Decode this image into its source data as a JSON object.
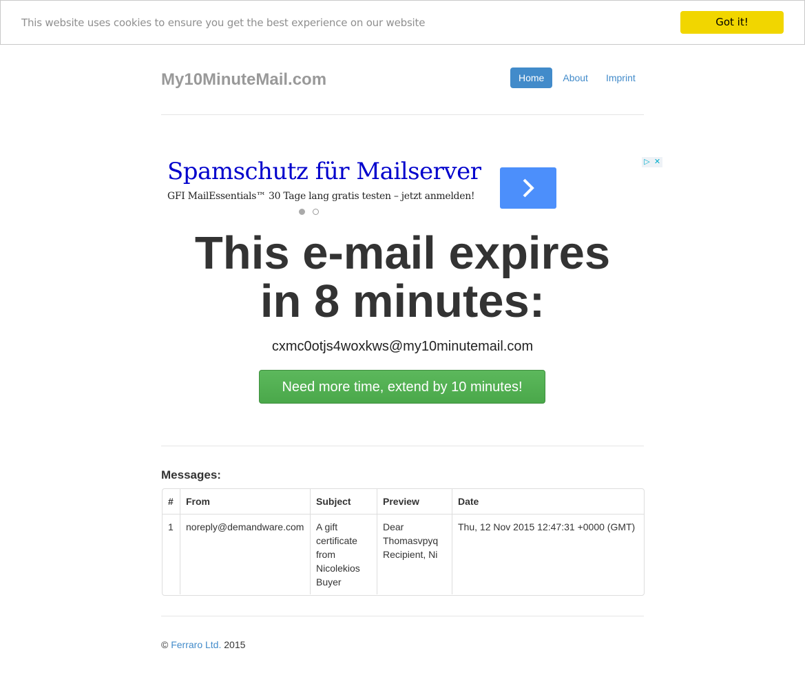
{
  "cookie": {
    "text": "This website uses cookies to ensure you get the best experience on our website",
    "button": "Got it!"
  },
  "header": {
    "brand": "My10MinuteMail.com",
    "nav": [
      "Home",
      "About",
      "Imprint"
    ],
    "active": "Home"
  },
  "ad": {
    "title": "Spamschutz für Mailserver",
    "subtitle": "GFI MailEssentials™ 30 Tage lang gratis testen – jetzt anmelden!",
    "arrow_icon": "chevron-right-icon",
    "choices_icons": [
      "ad-choices-icon",
      "close-icon"
    ]
  },
  "main": {
    "headline_line1": "This e-mail expires",
    "headline_line2": "in 8 minutes:",
    "address": "cxmc0otjs4woxkws@my10minutemail.com",
    "extend_button": "Need more time, extend by 10 minutes!"
  },
  "messages": {
    "title": "Messages:",
    "columns": [
      "#",
      "From",
      "Subject",
      "Preview",
      "Date"
    ],
    "rows": [
      {
        "num": "1",
        "from": "noreply@demandware.com",
        "subject": "A gift certificate from Nicolekios Buyer",
        "preview": "Dear Thomasvpyq Recipient, Ni",
        "date": "Thu, 12 Nov 2015 12:47:31 +0000 (GMT)"
      }
    ]
  },
  "footer": {
    "copyright": "©",
    "company": "Ferraro Ltd.",
    "year": "2015"
  },
  "colors": {
    "accent": "#428bca",
    "success": "#5cb85c",
    "cookie_button": "#f1d600"
  }
}
